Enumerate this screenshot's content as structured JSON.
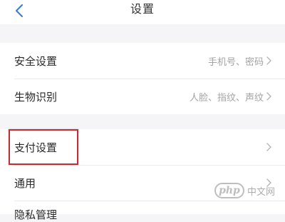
{
  "nav": {
    "title": "设置",
    "back_icon": "chevron-left-icon",
    "accent": "#3a7bd5"
  },
  "group_a": [
    {
      "label": "安全设置",
      "value": "手机号、密码"
    },
    {
      "label": "生物识别",
      "value": "人脸、指纹、声纹"
    }
  ],
  "group_b": [
    {
      "label": "支付设置",
      "value": ""
    },
    {
      "label": "通用",
      "value": ""
    }
  ],
  "partial_row": {
    "label": "隐私管理"
  },
  "highlight": {
    "color": "#b83237"
  },
  "watermark": {
    "logo": "php",
    "text": "中文网"
  }
}
